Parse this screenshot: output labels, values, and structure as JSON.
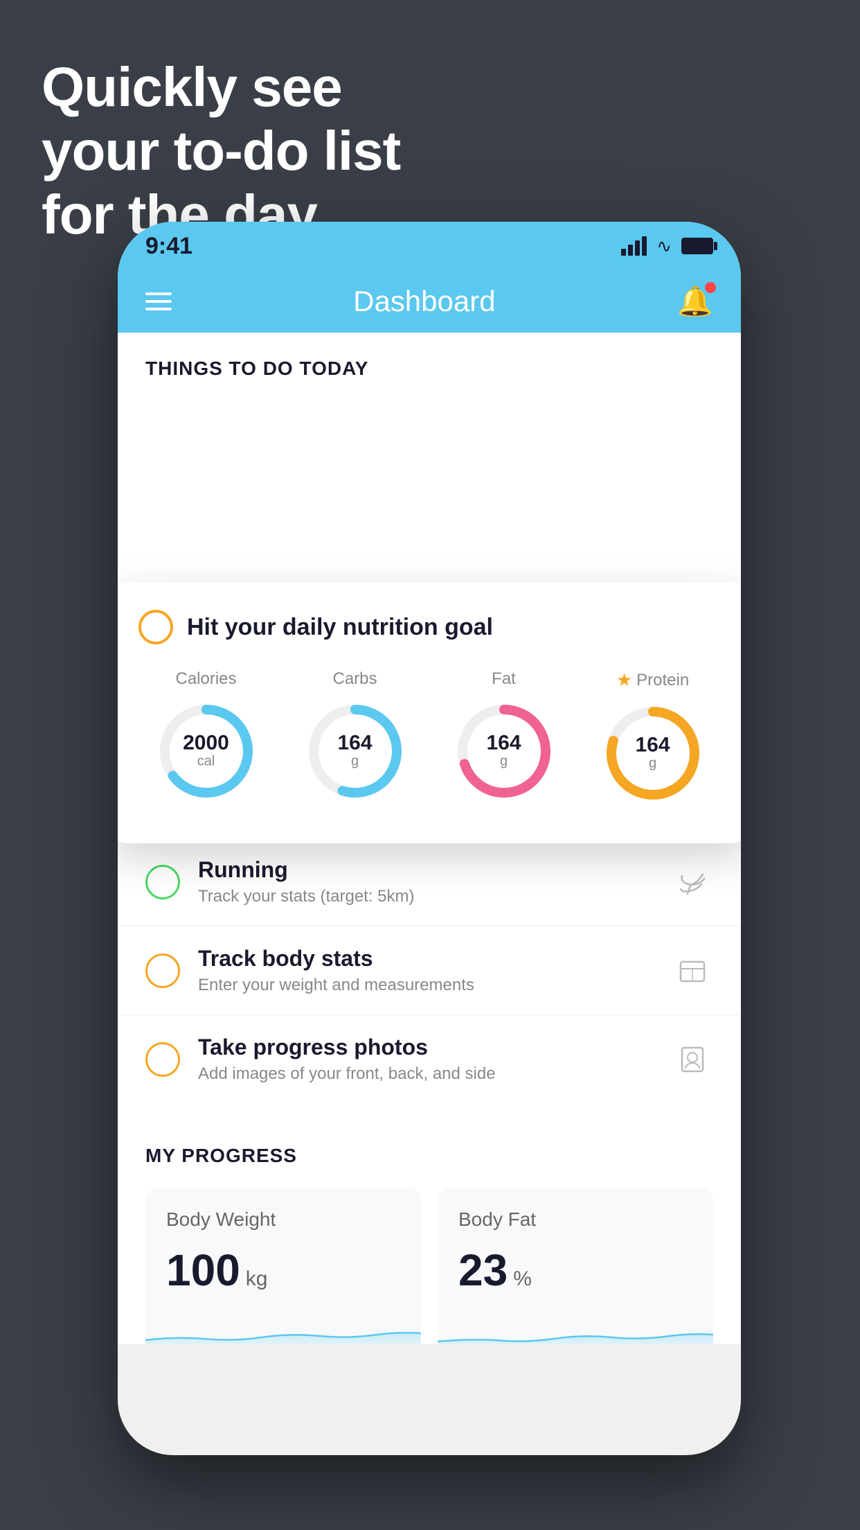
{
  "headline": {
    "line1": "Quickly see",
    "line2": "your to-do list",
    "line3": "for the day."
  },
  "statusBar": {
    "time": "9:41"
  },
  "header": {
    "title": "Dashboard"
  },
  "thingsToDo": {
    "sectionTitle": "THINGS TO DO TODAY"
  },
  "nutritionCard": {
    "title": "Hit your daily nutrition goal",
    "stats": [
      {
        "label": "Calories",
        "value": "2000",
        "unit": "cal",
        "color": "#5bc8ef",
        "percent": 65
      },
      {
        "label": "Carbs",
        "value": "164",
        "unit": "g",
        "color": "#5bc8ef",
        "percent": 55
      },
      {
        "label": "Fat",
        "value": "164",
        "unit": "g",
        "color": "#f06292",
        "percent": 70
      },
      {
        "label": "Protein",
        "value": "164",
        "unit": "g",
        "color": "#f5a623",
        "percent": 80,
        "starred": true
      }
    ]
  },
  "todoItems": [
    {
      "id": "running",
      "title": "Running",
      "subtitle": "Track your stats (target: 5km)",
      "circleColor": "green",
      "icon": "shoe"
    },
    {
      "id": "body-stats",
      "title": "Track body stats",
      "subtitle": "Enter your weight and measurements",
      "circleColor": "yellow",
      "icon": "scale"
    },
    {
      "id": "progress-photos",
      "title": "Take progress photos",
      "subtitle": "Add images of your front, back, and side",
      "circleColor": "yellow",
      "icon": "portrait"
    }
  ],
  "progressSection": {
    "title": "MY PROGRESS",
    "cards": [
      {
        "title": "Body Weight",
        "value": "100",
        "unit": "kg"
      },
      {
        "title": "Body Fat",
        "value": "23",
        "unit": "%"
      }
    ]
  }
}
